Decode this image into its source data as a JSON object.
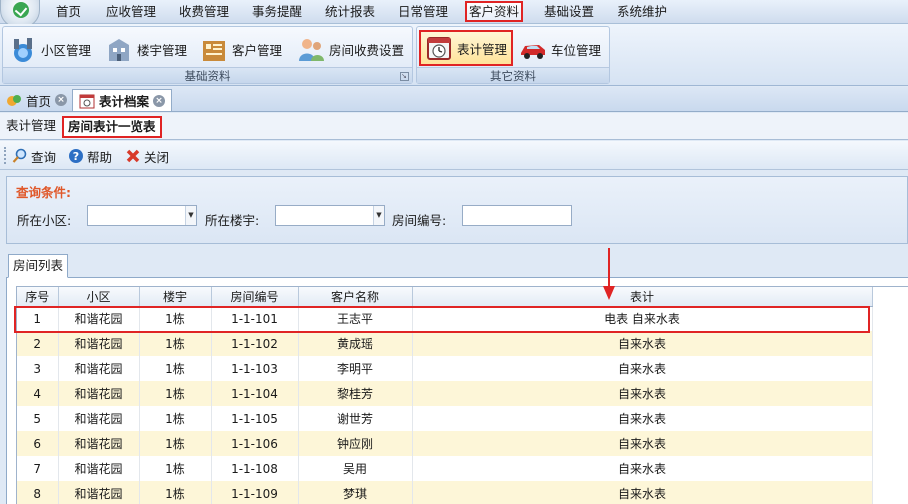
{
  "menu": {
    "items": [
      {
        "label": "首页"
      },
      {
        "label": "应收管理"
      },
      {
        "label": "收费管理"
      },
      {
        "label": "事务提醒"
      },
      {
        "label": "统计报表"
      },
      {
        "label": "日常管理"
      },
      {
        "label": "客户资料",
        "active": true
      },
      {
        "label": "基础设置"
      },
      {
        "label": "系统维护"
      }
    ]
  },
  "ribbon": {
    "group_basic": {
      "label": "基础资料",
      "buttons": [
        {
          "label": "小区管理",
          "icon": "community-icon"
        },
        {
          "label": "楼宇管理",
          "icon": "building-icon"
        },
        {
          "label": "客户管理",
          "icon": "customer-icon"
        },
        {
          "label": "房间收费设置",
          "icon": "room-fee-icon"
        }
      ]
    },
    "group_other": {
      "label": "其它资料",
      "buttons": [
        {
          "label": "表计管理",
          "icon": "meter-icon",
          "highlight": true
        },
        {
          "label": "车位管理",
          "icon": "car-icon"
        }
      ]
    }
  },
  "doc_tabs": [
    {
      "label": "首页",
      "icon": "home-icon"
    },
    {
      "label": "表计档案",
      "icon": "meter-doc-icon",
      "active": true
    }
  ],
  "sub_tabs": [
    {
      "label": "表计管理"
    },
    {
      "label": "房间表计一览表",
      "active": true
    }
  ],
  "toolbar": {
    "query_label": "查询",
    "help_label": "帮助",
    "close_label": "关闭"
  },
  "query": {
    "title": "查询条件:",
    "community_label": "所在小区:",
    "community_value": "",
    "building_label": "所在楼宇:",
    "building_value": "",
    "room_label": "房间编号:",
    "room_value": ""
  },
  "grid": {
    "tab_label": "房间列表",
    "columns": [
      "序号",
      "小区",
      "楼宇",
      "房间编号",
      "客户名称",
      "表计"
    ],
    "rows": [
      [
        "1",
        "和谐花园",
        "1栋",
        "1-1-101",
        "王志平",
        "电表 自来水表"
      ],
      [
        "2",
        "和谐花园",
        "1栋",
        "1-1-102",
        "黄成瑶",
        "自来水表"
      ],
      [
        "3",
        "和谐花园",
        "1栋",
        "1-1-103",
        "李明平",
        "自来水表"
      ],
      [
        "4",
        "和谐花园",
        "1栋",
        "1-1-104",
        "黎桂芳",
        "自来水表"
      ],
      [
        "5",
        "和谐花园",
        "1栋",
        "1-1-105",
        "谢世芳",
        "自来水表"
      ],
      [
        "6",
        "和谐花园",
        "1栋",
        "1-1-106",
        "钟应刚",
        "自来水表"
      ],
      [
        "7",
        "和谐花园",
        "1栋",
        "1-1-108",
        "吴用",
        "自来水表"
      ],
      [
        "8",
        "和谐花园",
        "1栋",
        "1-1-109",
        "梦琪",
        "自来水表"
      ]
    ]
  },
  "colors": {
    "highlight_border": "#e02424",
    "query_title": "#e0582a",
    "alt_row": "#fdf6d8"
  }
}
